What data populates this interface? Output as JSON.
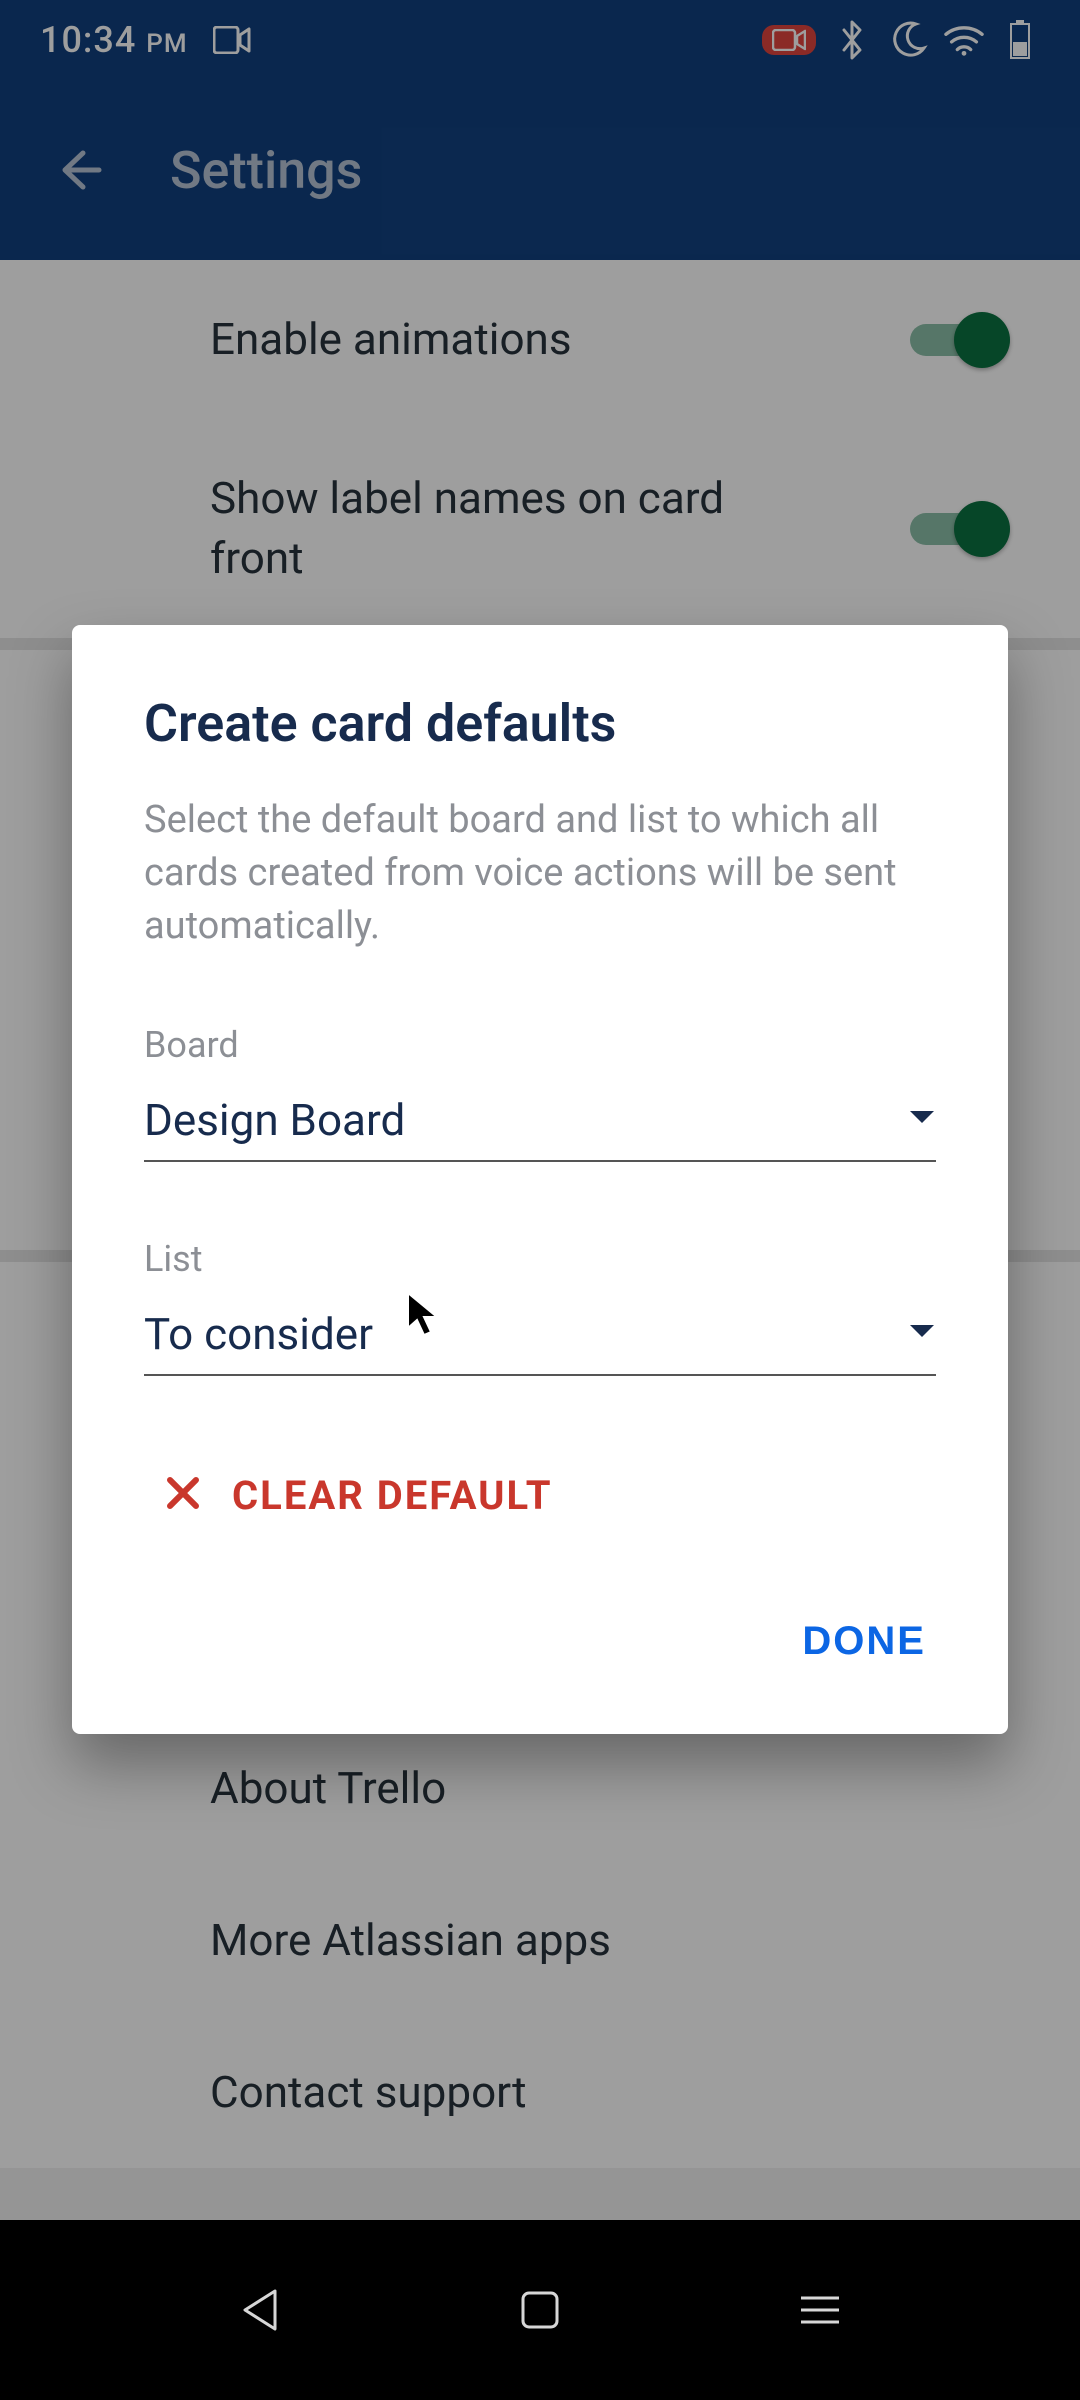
{
  "status": {
    "time": "10:34",
    "ampm": "PM"
  },
  "appbar": {
    "title": "Settings"
  },
  "settings": {
    "rows": [
      {
        "label": "Enable animations",
        "on": true
      },
      {
        "label": "Show label names on card front",
        "on": true
      }
    ]
  },
  "dialog": {
    "title": "Create card defaults",
    "description": "Select the default board and list to which all cards created from voice actions will be sent automatically.",
    "board_label": "Board",
    "board_value": "Design Board",
    "list_label": "List",
    "list_value": "To consider",
    "clear_label": "CLEAR DEFAULT",
    "done_label": "DONE"
  },
  "menu": {
    "about": "About Trello",
    "more_apps": "More Atlassian apps",
    "contact": "Contact support"
  }
}
